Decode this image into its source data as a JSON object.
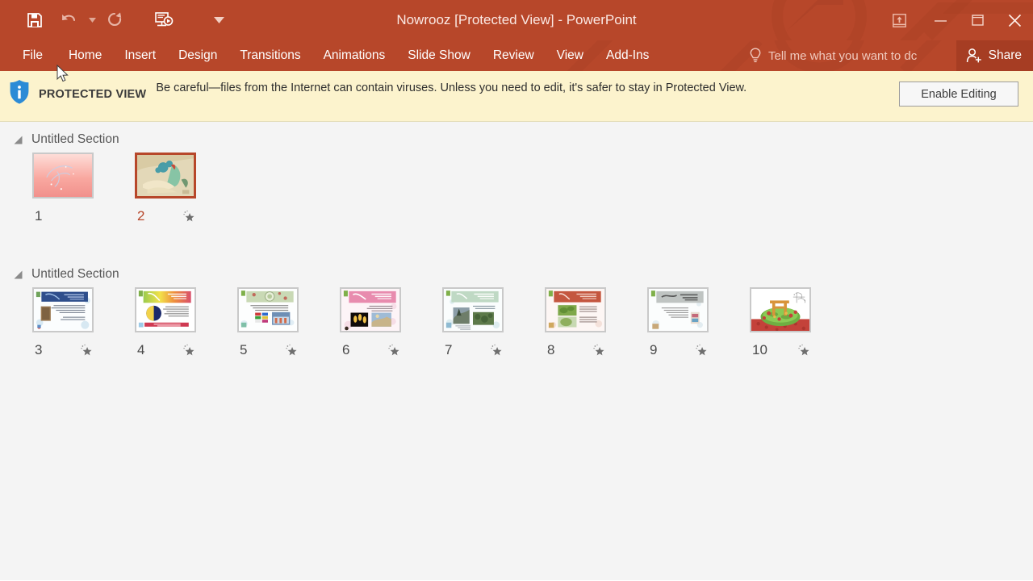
{
  "window": {
    "title": "Nowrooz [Protected View] - PowerPoint",
    "app_accent": "#B7472A",
    "share_bg": "#A63D23"
  },
  "quick_access": {
    "items": [
      {
        "name": "save",
        "label": "Save",
        "icon": "floppy-disk-icon"
      },
      {
        "name": "undo",
        "label": "Undo",
        "icon": "undo-arrow-icon",
        "has_caret": true
      },
      {
        "name": "redo",
        "label": "Redo",
        "icon": "redo-arrow-icon"
      },
      {
        "name": "start-slideshow",
        "label": "Start From Beginning",
        "icon": "slideshow-play-icon"
      }
    ],
    "customize_label": "Customize Quick Access Toolbar"
  },
  "window_controls": {
    "ribbon_display_label": "Ribbon Display Options",
    "minimize_label": "Minimize",
    "restore_label": "Restore Down",
    "close_label": "Close"
  },
  "ribbon": {
    "tabs": [
      {
        "label": "File"
      },
      {
        "label": "Home"
      },
      {
        "label": "Insert"
      },
      {
        "label": "Design"
      },
      {
        "label": "Transitions"
      },
      {
        "label": "Animations"
      },
      {
        "label": "Slide Show"
      },
      {
        "label": "Review"
      },
      {
        "label": "View"
      },
      {
        "label": "Add-Ins"
      }
    ],
    "tell_me_placeholder": "Tell me what you want to dc",
    "share_label": "Share"
  },
  "protected_view": {
    "badge": "PROTECTED VIEW",
    "message": "Be careful—files from the Internet can contain viruses. Unless you need to edit, it's safer to stay in Protected View.",
    "button_label": "Enable Editing",
    "bg": "#FCF3CD",
    "icon": "info-shield-icon"
  },
  "sorter": {
    "sections": [
      {
        "title": "Untitled Section",
        "collapsed": false,
        "slides": [
          {
            "number": "1",
            "selected": false,
            "has_animation": false,
            "theme": "pink-calligraphy"
          },
          {
            "number": "2",
            "selected": true,
            "has_animation": true,
            "theme": "peacock-watercolor"
          }
        ]
      },
      {
        "title": "Untitled Section",
        "collapsed": false,
        "slides": [
          {
            "number": "3",
            "selected": false,
            "has_animation": true,
            "theme": "blue-header-text"
          },
          {
            "number": "4",
            "selected": false,
            "has_animation": true,
            "theme": "rainbow-header-globe"
          },
          {
            "number": "5",
            "selected": false,
            "has_animation": true,
            "theme": "ornament-header-flags"
          },
          {
            "number": "6",
            "selected": false,
            "has_animation": true,
            "theme": "pink-header-candles"
          },
          {
            "number": "7",
            "selected": false,
            "has_animation": true,
            "theme": "green-header-landscape"
          },
          {
            "number": "8",
            "selected": false,
            "has_animation": true,
            "theme": "red-header-plants"
          },
          {
            "number": "9",
            "selected": false,
            "has_animation": true,
            "theme": "gray-header-text"
          },
          {
            "number": "10",
            "selected": false,
            "has_animation": true,
            "theme": "sabzeh-green-photo"
          }
        ]
      }
    ],
    "animation_icon": "animation-star-icon",
    "expand_icon": "section-triangle-icon"
  }
}
